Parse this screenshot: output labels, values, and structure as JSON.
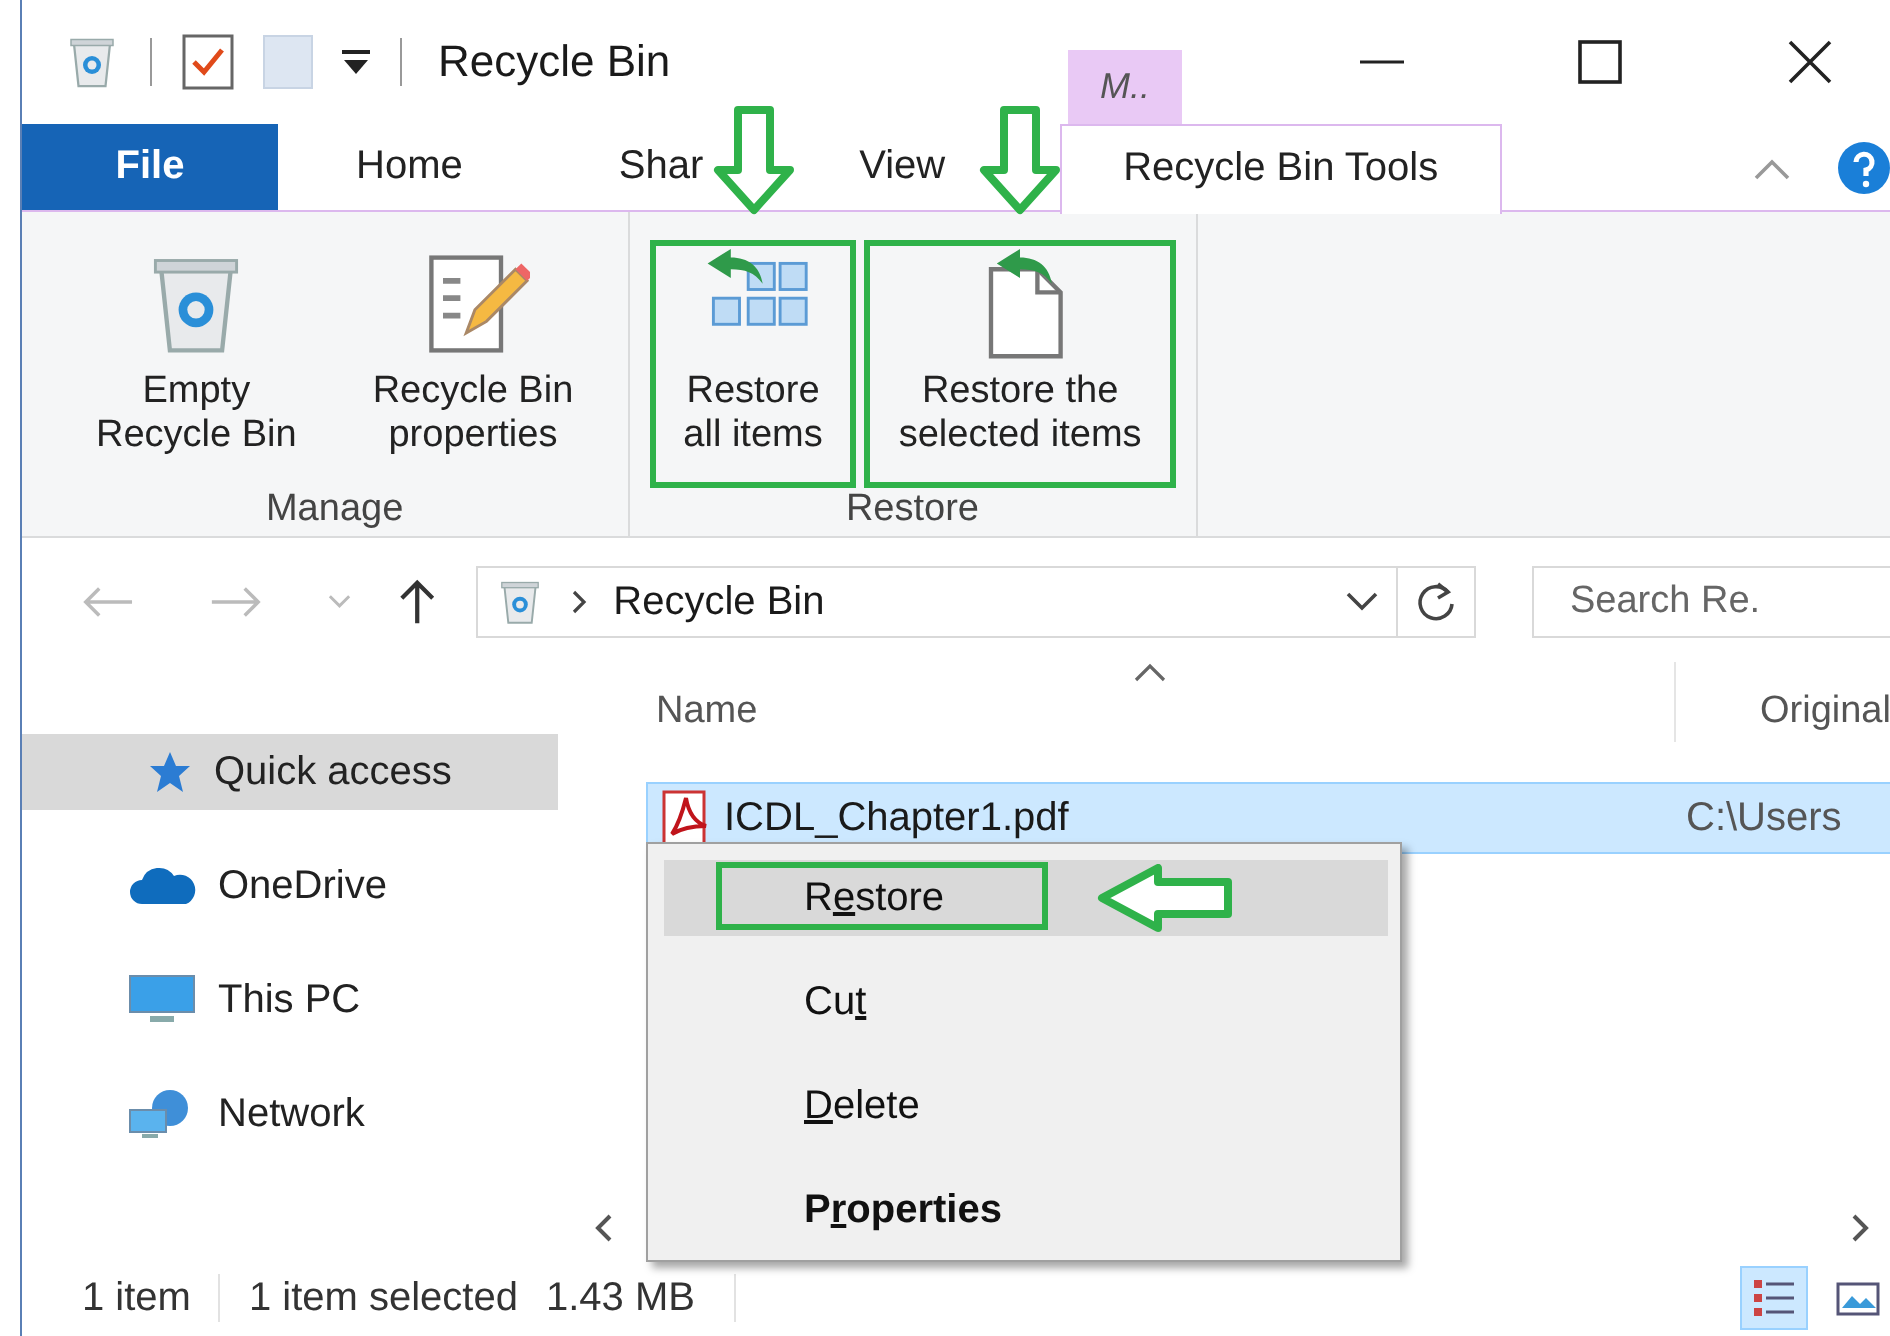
{
  "window": {
    "title": "Recycle Bin",
    "contextual_label": "M.."
  },
  "ribbon": {
    "tabs": [
      {
        "label": "File",
        "kind": "file",
        "selected": false
      },
      {
        "label": "Home",
        "kind": "plain",
        "selected": false
      },
      {
        "label": "Shar",
        "kind": "plain",
        "selected": false
      },
      {
        "label": "View",
        "kind": "plain",
        "selected": false
      },
      {
        "label": "Recycle Bin Tools",
        "kind": "contextual",
        "selected": true
      }
    ],
    "groups": [
      {
        "label": "Manage",
        "buttons": [
          {
            "lines": [
              "Empty",
              "Recycle Bin"
            ],
            "kind": "bin",
            "annotated": false
          },
          {
            "lines": [
              "Recycle Bin",
              "properties"
            ],
            "kind": "properties",
            "annotated": false
          }
        ]
      },
      {
        "label": "Restore",
        "buttons": [
          {
            "lines": [
              "Restore",
              "all items"
            ],
            "kind": "restore-all",
            "annotated": true
          },
          {
            "lines": [
              "Restore the",
              "selected items"
            ],
            "kind": "restore-selected",
            "annotated": true
          }
        ]
      }
    ]
  },
  "address_bar": {
    "path": "Recycle Bin",
    "search": {
      "placeholder": "Search Re."
    }
  },
  "sidebar": {
    "items": [
      {
        "label": "Quick access",
        "kind": "star",
        "selected": true
      },
      {
        "label": "OneDrive",
        "kind": "cloud",
        "selected": false
      },
      {
        "label": "This PC",
        "kind": "pc",
        "selected": false
      },
      {
        "label": "Network",
        "kind": "network",
        "selected": false
      }
    ]
  },
  "table": {
    "columns": [
      "Name",
      "Original"
    ],
    "rows": [
      {
        "name": "ICDL_Chapter1.pdf",
        "column_2": "C:\\Users",
        "selected": true
      }
    ]
  },
  "context_menu": {
    "items": [
      {
        "label_parts": [
          {
            "text": "R",
            "underlined": false
          },
          {
            "text": "e",
            "underlined": true
          },
          {
            "text": "store",
            "underlined": false
          }
        ],
        "bold": false,
        "highlighted": true,
        "annotated": true
      },
      {
        "label_parts": [
          {
            "text": "Cu",
            "underlined": false
          },
          {
            "text": "t",
            "underlined": true
          }
        ],
        "bold": false,
        "highlighted": false,
        "annotated": false
      },
      {
        "label_parts": [
          {
            "text": "D",
            "underlined": true
          },
          {
            "text": "elete",
            "underlined": false
          }
        ],
        "bold": false,
        "highlighted": false,
        "annotated": false
      },
      {
        "label_parts": [
          {
            "text": "P",
            "underlined": false
          },
          {
            "text": "r",
            "underlined": true
          },
          {
            "text": "operties",
            "underlined": false
          }
        ],
        "bold": true,
        "highlighted": false,
        "annotated": false
      }
    ]
  },
  "status_bar": {
    "texts": [
      "1 item",
      "1 item selected",
      "1.43 MB"
    ],
    "views": [
      {
        "kind": "details",
        "selected": true
      },
      {
        "kind": "large",
        "selected": false
      }
    ]
  }
}
